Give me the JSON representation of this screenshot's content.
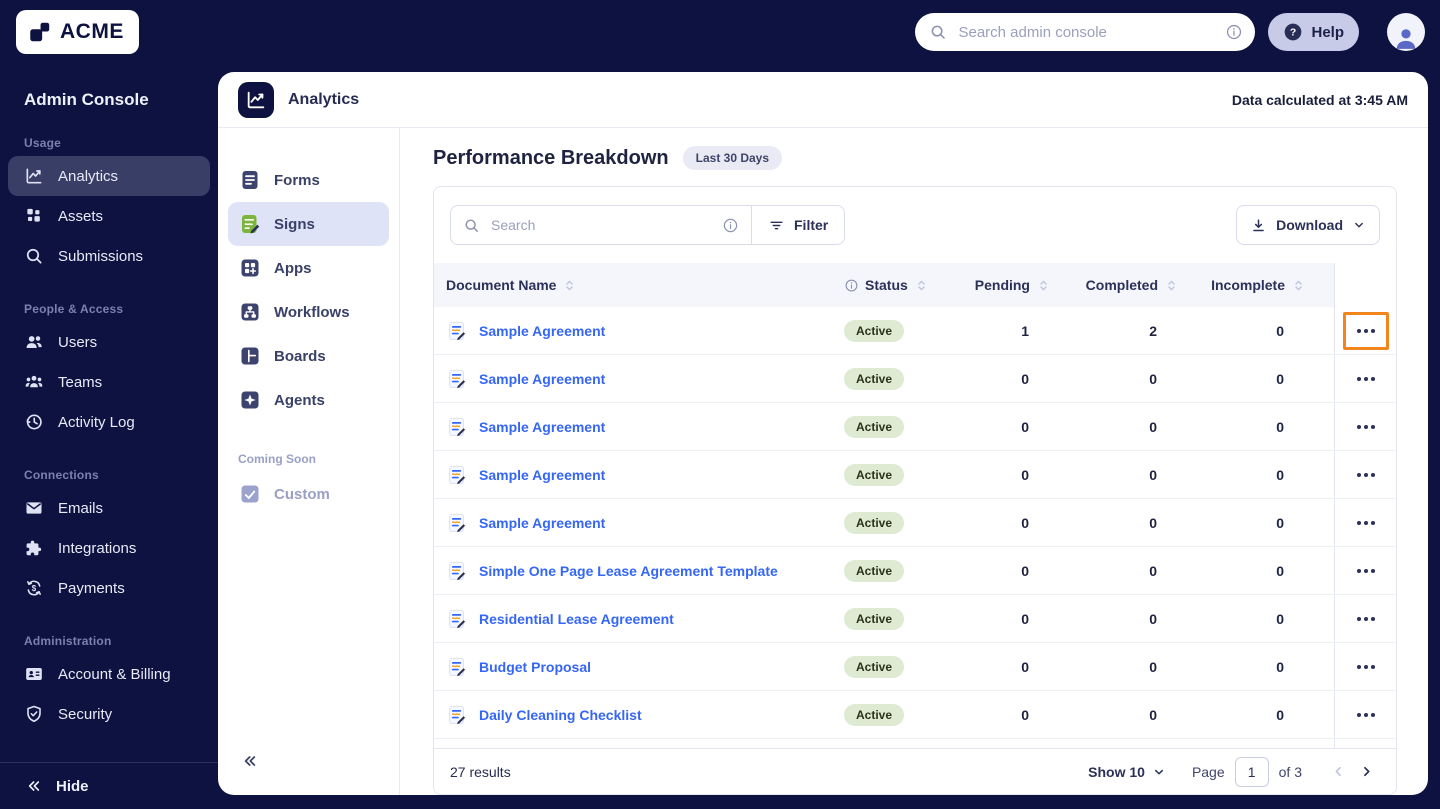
{
  "colors": {
    "navy_bg": "#0d1240",
    "link_blue": "#3566f6",
    "badge_green_bg": "#dfead2",
    "badge_green_text": "#29321c",
    "highlight_orange": "#f2861d",
    "selected_lavender": "#dfe3f7",
    "signs_green": "#7cb53d"
  },
  "topbar": {
    "brand": "ACME",
    "search_placeholder": "Search admin console",
    "help_label": "Help"
  },
  "sidebar": {
    "title": "Admin Console",
    "sections": {
      "usage": {
        "label": "Usage",
        "items": [
          {
            "id": "analytics",
            "label": "Analytics",
            "icon": "analytics",
            "active": true
          },
          {
            "id": "assets",
            "label": "Assets",
            "icon": "assets"
          },
          {
            "id": "submissions",
            "label": "Submissions",
            "icon": "submissions"
          }
        ]
      },
      "people": {
        "label": "People & Access",
        "items": [
          {
            "id": "users",
            "label": "Users",
            "icon": "users"
          },
          {
            "id": "teams",
            "label": "Teams",
            "icon": "teams"
          },
          {
            "id": "activity-log",
            "label": "Activity Log",
            "icon": "activity"
          }
        ]
      },
      "connections": {
        "label": "Connections",
        "items": [
          {
            "id": "emails",
            "label": "Emails",
            "icon": "emails"
          },
          {
            "id": "integrations",
            "label": "Integrations",
            "icon": "integrations"
          },
          {
            "id": "payments",
            "label": "Payments",
            "icon": "payments"
          }
        ]
      },
      "admin": {
        "label": "Administration",
        "items": [
          {
            "id": "account-billing",
            "label": "Account & Billing",
            "icon": "billing"
          },
          {
            "id": "security",
            "label": "Security",
            "icon": "security"
          }
        ]
      }
    },
    "hide_label": "Hide"
  },
  "panel": {
    "title": "Analytics",
    "data_note": "Data calculated at 3:45 AM"
  },
  "inner_nav": {
    "items": [
      {
        "id": "forms",
        "label": "Forms",
        "icon": "forms"
      },
      {
        "id": "signs",
        "label": "Signs",
        "icon": "signs",
        "selected": true
      },
      {
        "id": "apps",
        "label": "Apps",
        "icon": "apps"
      },
      {
        "id": "workflows",
        "label": "Workflows",
        "icon": "workflows"
      },
      {
        "id": "boards",
        "label": "Boards",
        "icon": "boards"
      },
      {
        "id": "agents",
        "label": "Agents",
        "icon": "agents"
      }
    ],
    "coming_soon_label": "Coming Soon",
    "coming_soon_item": {
      "id": "custom",
      "label": "Custom"
    }
  },
  "main": {
    "title": "Performance Breakdown",
    "period_badge": "Last 30 Days",
    "toolbar": {
      "search_placeholder": "Search",
      "filter_label": "Filter",
      "download_label": "Download"
    },
    "table": {
      "columns": {
        "name": "Document Name",
        "status": "Status",
        "pending": "Pending",
        "completed": "Completed",
        "incomplete": "Incomplete"
      },
      "rows": [
        {
          "name": "Sample Agreement",
          "status": "Active",
          "pending": "1",
          "completed": "2",
          "incomplete": "0",
          "highlighted": true
        },
        {
          "name": "Sample Agreement",
          "status": "Active",
          "pending": "0",
          "completed": "0",
          "incomplete": "0"
        },
        {
          "name": "Sample Agreement",
          "status": "Active",
          "pending": "0",
          "completed": "0",
          "incomplete": "0"
        },
        {
          "name": "Sample Agreement",
          "status": "Active",
          "pending": "0",
          "completed": "0",
          "incomplete": "0"
        },
        {
          "name": "Sample Agreement",
          "status": "Active",
          "pending": "0",
          "completed": "0",
          "incomplete": "0"
        },
        {
          "name": "Simple One Page Lease Agreement Template",
          "status": "Active",
          "pending": "0",
          "completed": "0",
          "incomplete": "0"
        },
        {
          "name": "Residential Lease Agreement",
          "status": "Active",
          "pending": "0",
          "completed": "0",
          "incomplete": "0"
        },
        {
          "name": "Budget Proposal",
          "status": "Active",
          "pending": "0",
          "completed": "0",
          "incomplete": "0"
        },
        {
          "name": "Daily Cleaning Checklist",
          "status": "Active",
          "pending": "0",
          "completed": "0",
          "incomplete": "0"
        }
      ]
    },
    "footer": {
      "results": "27 results",
      "show_label": "Show 10",
      "page_label": "Page",
      "page_value": "1",
      "of_label": "of 3"
    }
  }
}
